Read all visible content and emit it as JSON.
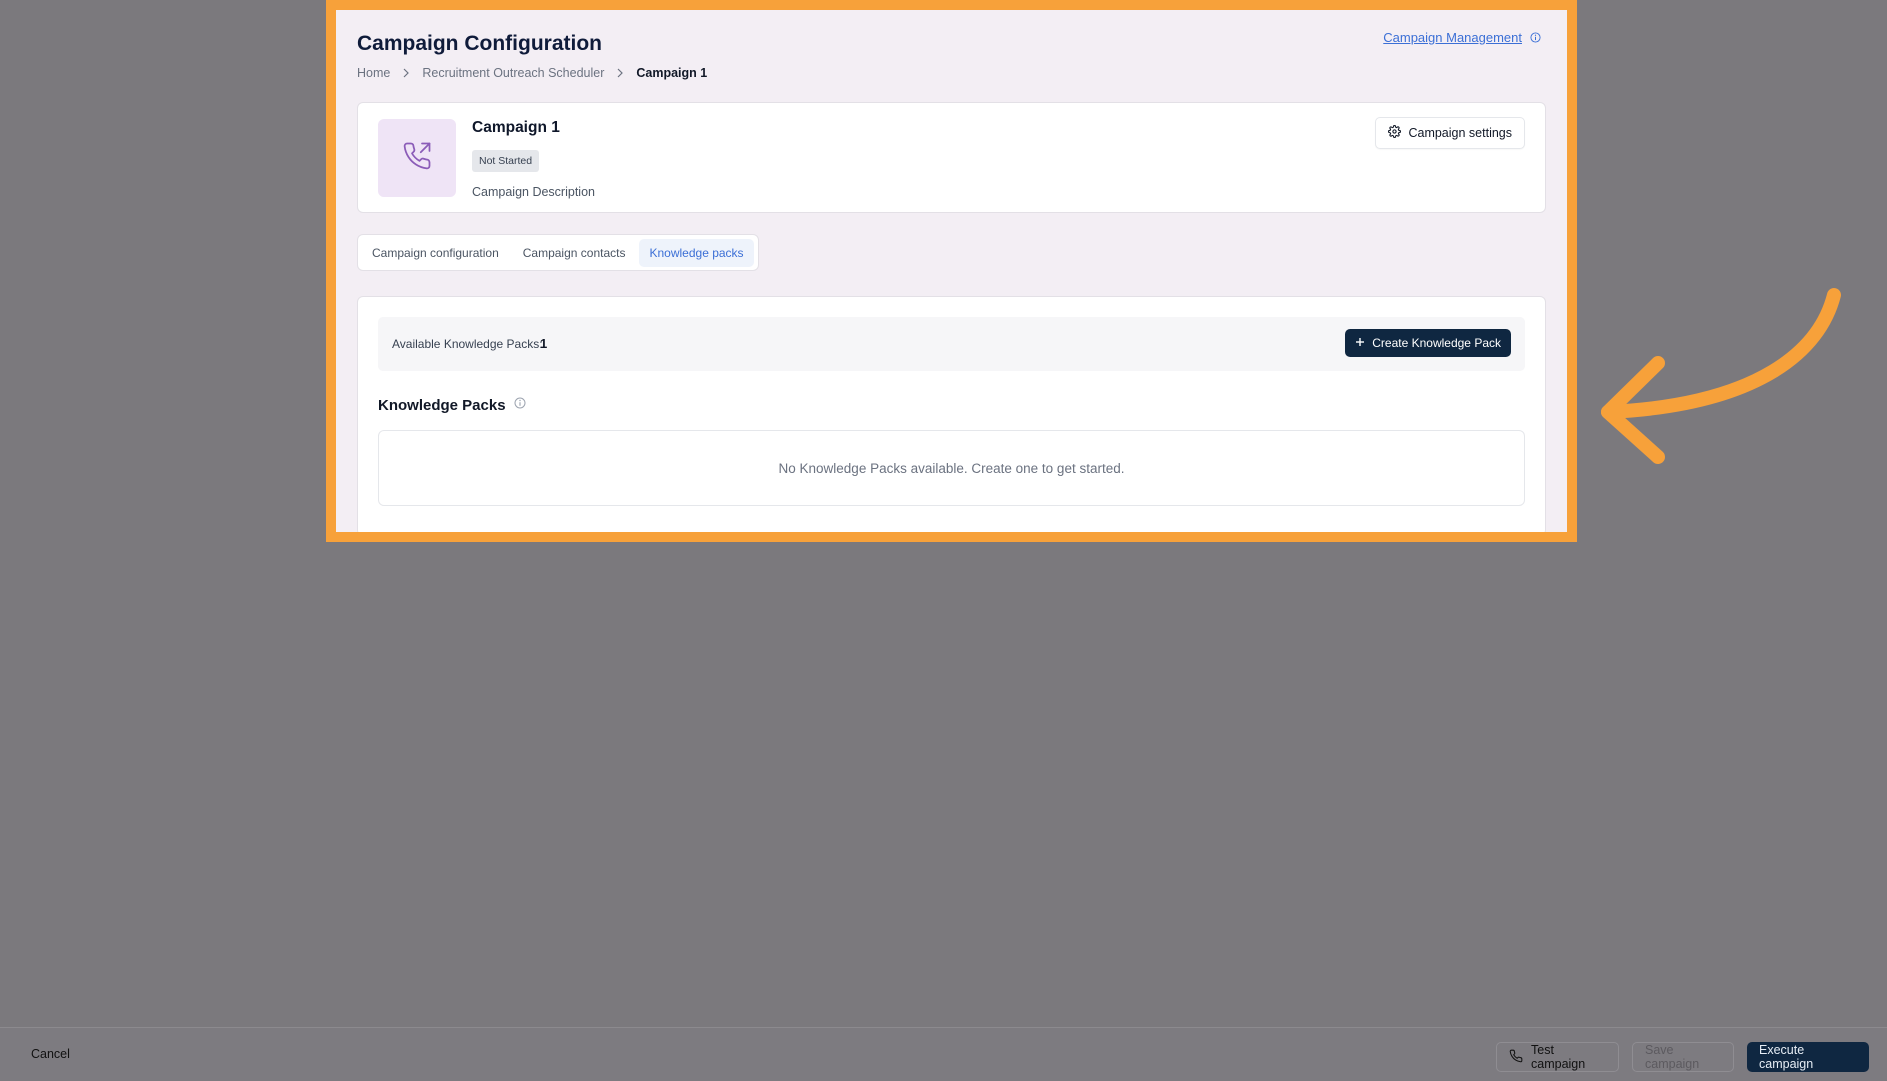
{
  "colors": {
    "highlight": "#f7a13a",
    "overlay": "#7b797d",
    "panel_bg": "#f3eef4",
    "primary_dark": "#0f2741",
    "link_blue": "#3b6fd6",
    "avatar_bg": "#efe4f6",
    "avatar_icon": "#8b5cb8"
  },
  "header": {
    "title": "Campaign Configuration",
    "top_link": "Campaign Management",
    "top_link_icon": "info-icon"
  },
  "breadcrumb": {
    "items": [
      "Home",
      "Recruitment Outreach Scheduler",
      "Campaign 1"
    ]
  },
  "campaign": {
    "name": "Campaign 1",
    "status": "Not Started",
    "description": "Campaign Description",
    "avatar_icon": "phone-outgoing-icon",
    "settings_label": "Campaign settings",
    "settings_icon": "gear-icon"
  },
  "tabs": [
    {
      "label": "Campaign configuration",
      "active": false
    },
    {
      "label": "Campaign contacts",
      "active": false
    },
    {
      "label": "Knowledge packs",
      "active": true
    }
  ],
  "knowledge": {
    "available_label": "Available Knowledge Packs:",
    "available_count": "1",
    "create_label": "Create Knowledge Pack",
    "create_icon": "plus-icon",
    "section_title": "Knowledge Packs",
    "empty_text": "No Knowledge Packs available. Create one to get started."
  },
  "footer": {
    "cancel_label": "Cancel",
    "test_label": "Test campaign",
    "test_icon": "phone-icon",
    "save_label": "Save campaign",
    "execute_label": "Execute campaign"
  }
}
